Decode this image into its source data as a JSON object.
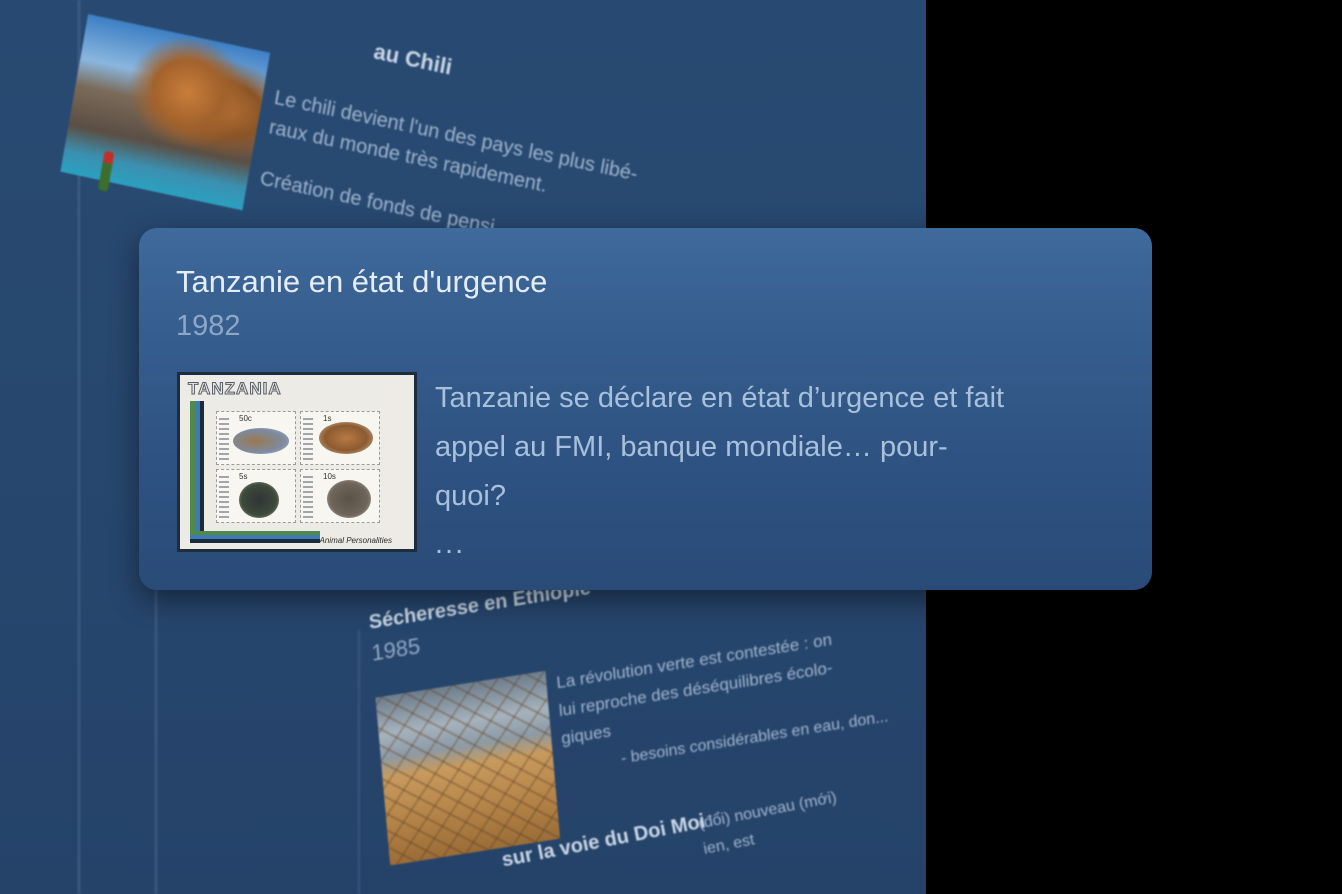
{
  "background": {
    "chile": {
      "title": "au Chili",
      "text_lines": [
        "Le chili devient l'un des pays les plus libé-",
        "raux du monde très rapidement.",
        "",
        "Création de fonds de pensi..."
      ]
    },
    "ethiopia": {
      "title": "Sécheresse en Ethiopie",
      "year": "1985",
      "text_lines": [
        "La révolution verte est contestée : on",
        "lui reproche des déséquilibres écolo-",
        "giques"
      ],
      "subtext": "- besoins considérables en eau, don..."
    },
    "doimoi": {
      "title": "sur la voie du Doi Moi",
      "text_lines": [
        "(đổi) nouveau (mới)",
        "ien, est"
      ]
    }
  },
  "card": {
    "title": "Tanzanie en état d'urgence",
    "year": "1982",
    "image": {
      "country": "TANZANIA",
      "stamp_values": [
        "50c",
        "1s",
        "5s",
        "10s"
      ],
      "stamp_side_label": "TANZANIA",
      "caption": "Animal Personalities"
    },
    "description_lines": [
      "Tanzanie se déclare en état d’urgence et fait",
      "appel au FMI, banque mondiale… pour-",
      "quoi?"
    ],
    "ellipsis": "..."
  },
  "colors": {
    "background_panel": "#284a72",
    "card_top": "#3f6a9c",
    "card_bottom": "#2a4b78",
    "title_text": "#e4ecf6",
    "year_text": "#8ea7c7",
    "body_text": "#a8c0dc"
  }
}
